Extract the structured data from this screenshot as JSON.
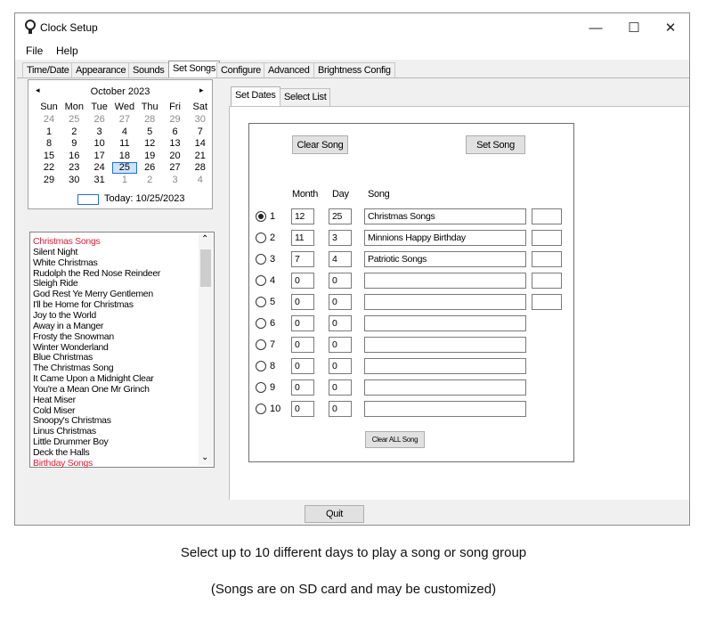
{
  "window": {
    "title": "Clock Setup",
    "controls": [
      "—",
      "☐",
      "✕"
    ]
  },
  "menu": [
    "File",
    "Help"
  ],
  "tabs": [
    "Time/Date",
    "Appearance",
    "Sounds",
    "Set Songs",
    "Configure",
    "Advanced",
    "Brightness Config"
  ],
  "active_tab": "Set Songs",
  "calendar": {
    "month_label": "October 2023",
    "prev": "◂",
    "next": "▸",
    "weekdays": [
      "Sun",
      "Mon",
      "Tue",
      "Wed",
      "Thu",
      "Fri",
      "Sat"
    ],
    "weeks": [
      [
        "24",
        "25",
        "26",
        "27",
        "28",
        "29",
        "30"
      ],
      [
        "1",
        "2",
        "3",
        "4",
        "5",
        "6",
        "7"
      ],
      [
        "8",
        "9",
        "10",
        "11",
        "12",
        "13",
        "14"
      ],
      [
        "15",
        "16",
        "17",
        "18",
        "19",
        "20",
        "21"
      ],
      [
        "22",
        "23",
        "24",
        "25",
        "26",
        "27",
        "28"
      ],
      [
        "29",
        "30",
        "31",
        "1",
        "2",
        "3",
        "4"
      ]
    ],
    "selected_day": "25",
    "today_label": "Today: 10/25/2023"
  },
  "songs": [
    "Christmas Songs",
    "Silent Night",
    "White Christmas",
    "Rudolph the Red Nose Reindeer",
    "Sleigh Ride",
    "God Rest Ye Merry Gentlemen",
    "I'll be Home for Christmas",
    "Joy to the World",
    "Away in a Manger",
    "Frosty the Snowman",
    "Winter Wonderland",
    "Blue Christmas",
    "The Christmas Song",
    "It Came Upon a Midnight Clear",
    "You're a Mean One Mr Grinch",
    "Heat Miser",
    "Cold Miser",
    "Snoopy's Christmas",
    "Linus Christmas",
    "Little Drummer Boy",
    "Deck the Halls",
    "Birthday Songs"
  ],
  "song_groups": [
    "Christmas Songs",
    "Birthday Songs"
  ],
  "inner_tabs": [
    "Set Dates",
    "Select List"
  ],
  "buttons": {
    "clear_song": "Clear Song",
    "set_song": "Set Song",
    "clear_all": "Clear ALL Song",
    "quit": "Quit"
  },
  "headers": {
    "month": "Month",
    "day": "Day",
    "song": "Song"
  },
  "rows": [
    {
      "num": "1",
      "month": "12",
      "day": "25",
      "song": "Christmas Songs",
      "selected": true
    },
    {
      "num": "2",
      "month": "11",
      "day": "3",
      "song": "Minnions Happy Birthday",
      "selected": false
    },
    {
      "num": "3",
      "month": "7",
      "day": "4",
      "song": "Patriotic Songs",
      "selected": false
    },
    {
      "num": "4",
      "month": "0",
      "day": "0",
      "song": "",
      "selected": false
    },
    {
      "num": "5",
      "month": "0",
      "day": "0",
      "song": "",
      "selected": false
    },
    {
      "num": "6",
      "month": "0",
      "day": "0",
      "song": "",
      "selected": false
    },
    {
      "num": "7",
      "month": "0",
      "day": "0",
      "song": "",
      "selected": false
    },
    {
      "num": "8",
      "month": "0",
      "day": "0",
      "song": "",
      "selected": false
    },
    {
      "num": "9",
      "month": "0",
      "day": "0",
      "song": "",
      "selected": false
    },
    {
      "num": "10",
      "month": "0",
      "day": "0",
      "song": "",
      "selected": false
    }
  ],
  "caption": {
    "line1": "Select up to 10 different days to play a song or song group",
    "line2": "(Songs are on SD card and may be customized)"
  },
  "colors": {
    "song_group": "#e0243a",
    "window_bg": "#f0f0f0"
  }
}
